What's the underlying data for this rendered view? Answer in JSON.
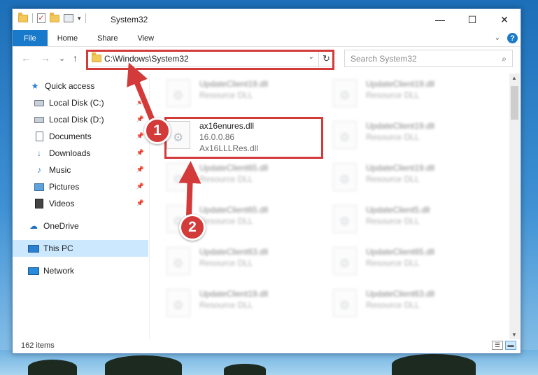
{
  "titlebar": {
    "title": "System32",
    "minimize": "—",
    "maximize": "☐",
    "close": "✕"
  },
  "ribbon": {
    "tabs": [
      "File",
      "Home",
      "Share",
      "View"
    ]
  },
  "navigation": {
    "back": "←",
    "forward": "→",
    "recent": "⌄",
    "up": "↑",
    "address": "C:\\Windows\\System32",
    "search_placeholder": "Search System32"
  },
  "sidebar": {
    "items": [
      {
        "label": "Quick access",
        "icon": "star-icon"
      },
      {
        "label": "Local Disk (C:)",
        "icon": "drive-icon",
        "pinned": true
      },
      {
        "label": "Local Disk (D:)",
        "icon": "drive-icon",
        "pinned": true
      },
      {
        "label": "Documents",
        "icon": "document-icon",
        "pinned": true
      },
      {
        "label": "Downloads",
        "icon": "download-icon",
        "pinned": true
      },
      {
        "label": "Music",
        "icon": "music-icon",
        "pinned": true
      },
      {
        "label": "Pictures",
        "icon": "pictures-icon",
        "pinned": true
      },
      {
        "label": "Videos",
        "icon": "videos-icon",
        "pinned": true
      },
      {
        "label": "OneDrive",
        "icon": "cloud-icon"
      },
      {
        "label": "This PC",
        "icon": "computer-icon",
        "selected": true
      },
      {
        "label": "Network",
        "icon": "network-icon"
      }
    ]
  },
  "files": {
    "left": [
      {
        "name": "UpdateClient19.dll",
        "type": "Resource DLL",
        "blurred": true
      },
      {
        "name": "ax16enures.dll",
        "version": "16.0.0.86",
        "description": "Ax16LLLRes.dll",
        "blurred": false
      },
      {
        "name": "UpdateClient65.dll",
        "type": "Resource DLL",
        "blurred": true
      },
      {
        "name": "UpdateClient65.dll",
        "type": "Resource DLL",
        "blurred": true
      },
      {
        "name": "UpdateClient63.dll",
        "type": "Resource DLL",
        "blurred": true
      },
      {
        "name": "UpdateClient19.dll",
        "type": "Resource DLL",
        "blurred": true
      }
    ],
    "right": [
      {
        "name": "UpdateClient19.dll",
        "type": "Resource DLL"
      },
      {
        "name": "UpdateClient19.dll",
        "type": "Resource DLL"
      },
      {
        "name": "UpdateClient19.dll",
        "type": "Resource DLL"
      },
      {
        "name": "UpdateClient5.dll",
        "type": "Resource DLL"
      },
      {
        "name": "UpdateClient65.dll",
        "type": "Resource DLL"
      },
      {
        "name": "UpdateClient63.dll",
        "type": "Resource DLL"
      }
    ]
  },
  "status": {
    "item_count": "162 items"
  },
  "annotations": {
    "step1": "1",
    "step2": "2",
    "highlight_color": "#d33a3a"
  },
  "colors": {
    "accent": "#1979ca",
    "selected_bg": "#cce8ff"
  }
}
